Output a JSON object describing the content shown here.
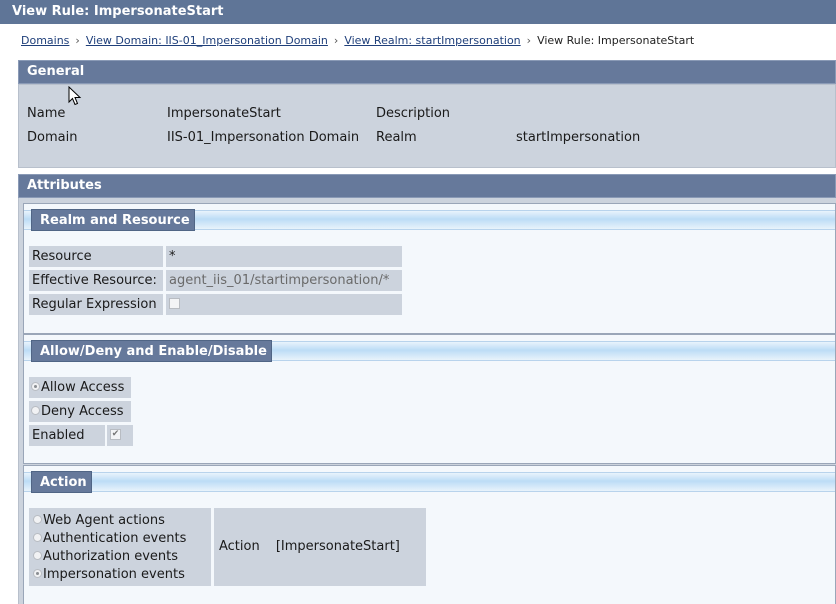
{
  "window": {
    "title": "View Rule: ImpersonateStart"
  },
  "breadcrumb": {
    "items": [
      "Domains",
      "View Domain: IIS-01_Impersonation Domain",
      "View Realm: startImpersonation"
    ],
    "current": "View Rule: ImpersonateStart",
    "separator": "›"
  },
  "general": {
    "title": "General",
    "name_label": "Name",
    "name_value": "ImpersonateStart",
    "description_label": "Description",
    "description_value": "",
    "domain_label": "Domain",
    "domain_value": "IIS-01_Impersonation Domain",
    "realm_label": "Realm",
    "realm_value": "startImpersonation"
  },
  "attributes": {
    "title": "Attributes",
    "realm_resource": {
      "title": "Realm and Resource",
      "resource_label": "Resource",
      "resource_value": "*",
      "effective_label": "Effective Resource:",
      "effective_value": "agent_iis_01/startimpersonation/*",
      "regex_label": "Regular Expression",
      "regex_checked": false
    },
    "allow_deny": {
      "title": "Allow/Deny and Enable/Disable",
      "allow_label": "Allow Access",
      "deny_label": "Deny Access",
      "selected": "Allow Access",
      "enabled_label": "Enabled",
      "enabled_checked": true
    },
    "action": {
      "title": "Action",
      "options": [
        "Web Agent actions",
        "Authentication events",
        "Authorization events",
        "Impersonation events"
      ],
      "selected": "Impersonation events",
      "action_label": "Action",
      "action_value": "[ImpersonateStart]"
    }
  },
  "icons": {
    "cursor": "mouse-pointer-icon",
    "radio": "radio-icon",
    "check": "checkmark-icon"
  },
  "colors": {
    "titlebar": "#5f7597",
    "section_header": "#66799b",
    "panel_bg": "#f4f8fc",
    "cell_bg": "#ccd3dd"
  }
}
